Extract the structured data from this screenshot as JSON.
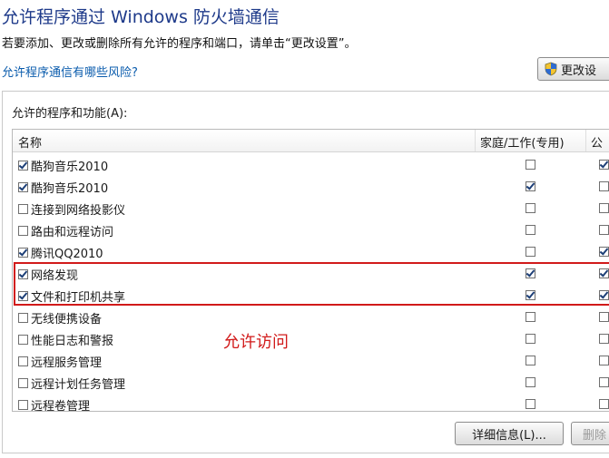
{
  "title": "允许程序通过 Windows 防火墙通信",
  "description": "若要添加、更改或删除所有允许的程序和端口，请单击“更改设置”。",
  "risk_link": "允许程序通信有哪些风险?",
  "change_settings_button": "更改设",
  "list_label": "允许的程序和功能(A):",
  "columns": {
    "name": "名称",
    "home_work": "家庭/工作(专用)",
    "public": "公"
  },
  "rows": [
    {
      "name": "酷狗音乐2010",
      "enabled": true,
      "home": false,
      "public": true
    },
    {
      "name": "酷狗音乐2010",
      "enabled": true,
      "home": true,
      "public": false
    },
    {
      "name": "连接到网络投影仪",
      "enabled": false,
      "home": false,
      "public": false
    },
    {
      "name": "路由和远程访问",
      "enabled": false,
      "home": false,
      "public": false
    },
    {
      "name": "腾讯QQ2010",
      "enabled": true,
      "home": false,
      "public": true
    },
    {
      "name": "网络发现",
      "enabled": true,
      "home": true,
      "public": true
    },
    {
      "name": "文件和打印机共享",
      "enabled": true,
      "home": true,
      "public": true
    },
    {
      "name": "无线便携设备",
      "enabled": false,
      "home": false,
      "public": false
    },
    {
      "name": "性能日志和警报",
      "enabled": false,
      "home": false,
      "public": false
    },
    {
      "name": "远程服务管理",
      "enabled": false,
      "home": false,
      "public": false
    },
    {
      "name": "远程计划任务管理",
      "enabled": false,
      "home": false,
      "public": false
    },
    {
      "name": "远程卷管理",
      "enabled": false,
      "home": false,
      "public": false
    }
  ],
  "annotation": "允许访问",
  "details_button": "详细信息(L)...",
  "delete_button": "删除",
  "colors": {
    "title": "#1e3a8a",
    "link": "#0b5cad",
    "highlight": "#d11a1a"
  }
}
